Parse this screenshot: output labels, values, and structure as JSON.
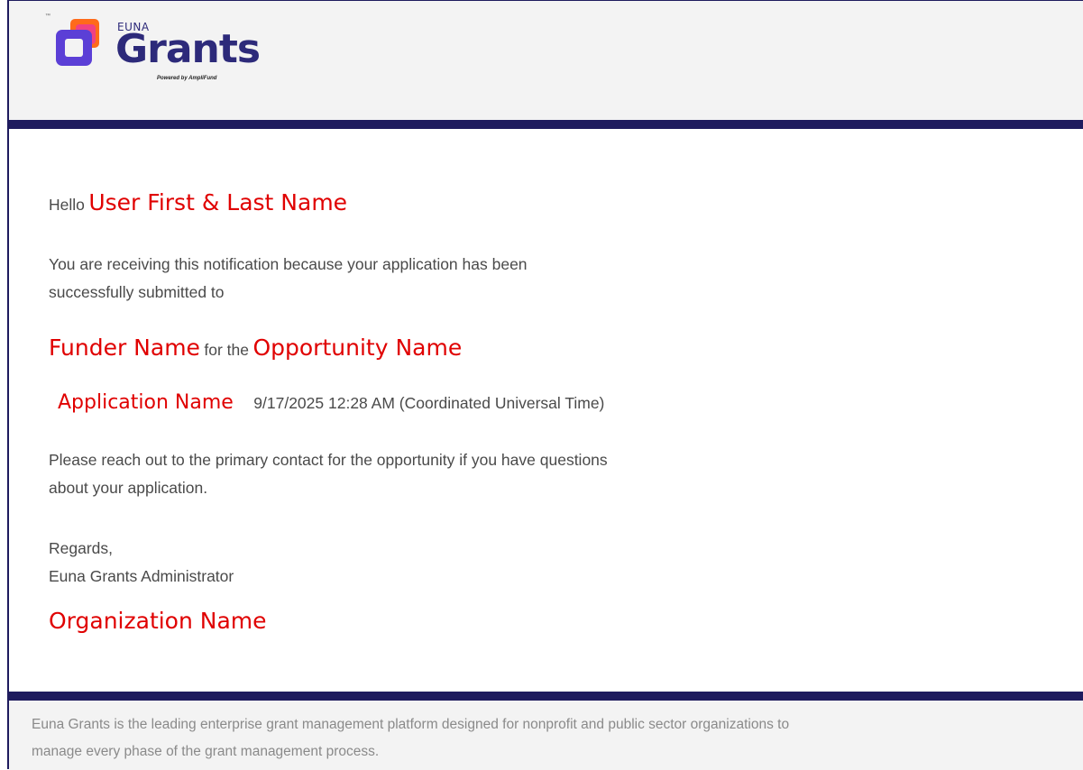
{
  "brand": {
    "tm": "™",
    "euna": "EUNA",
    "product": "Grants",
    "powered_by": "Powered by AmpliFund",
    "colors": {
      "navy": "#1e1b5e",
      "purple": "#5b3fd6",
      "orange": "#ff6a1a",
      "pink": "#ee3d8f"
    }
  },
  "email": {
    "greeting": "Hello",
    "user_name": "User First & Last Name",
    "notice_line1": "You are receiving this notification because your application has been",
    "notice_line2": "successfully submitted to",
    "funder_name": "Funder Name",
    "for_the": "for the",
    "opportunity_name": "Opportunity Name",
    "application_name": "Application Name",
    "submitted_at": "9/17/2025 12:28 AM (Coordinated Universal Time)",
    "contact_line1": "Please reach out to the primary contact for the opportunity if you have questions",
    "contact_line2": "about your application.",
    "regards": "Regards,",
    "signature": "Euna Grants Administrator",
    "organization_name": "Organization Name"
  },
  "footer": {
    "line1": "Euna Grants is the leading enterprise grant management platform designed for nonprofit and public sector organizations to",
    "line2": "manage every phase of the grant management process."
  }
}
